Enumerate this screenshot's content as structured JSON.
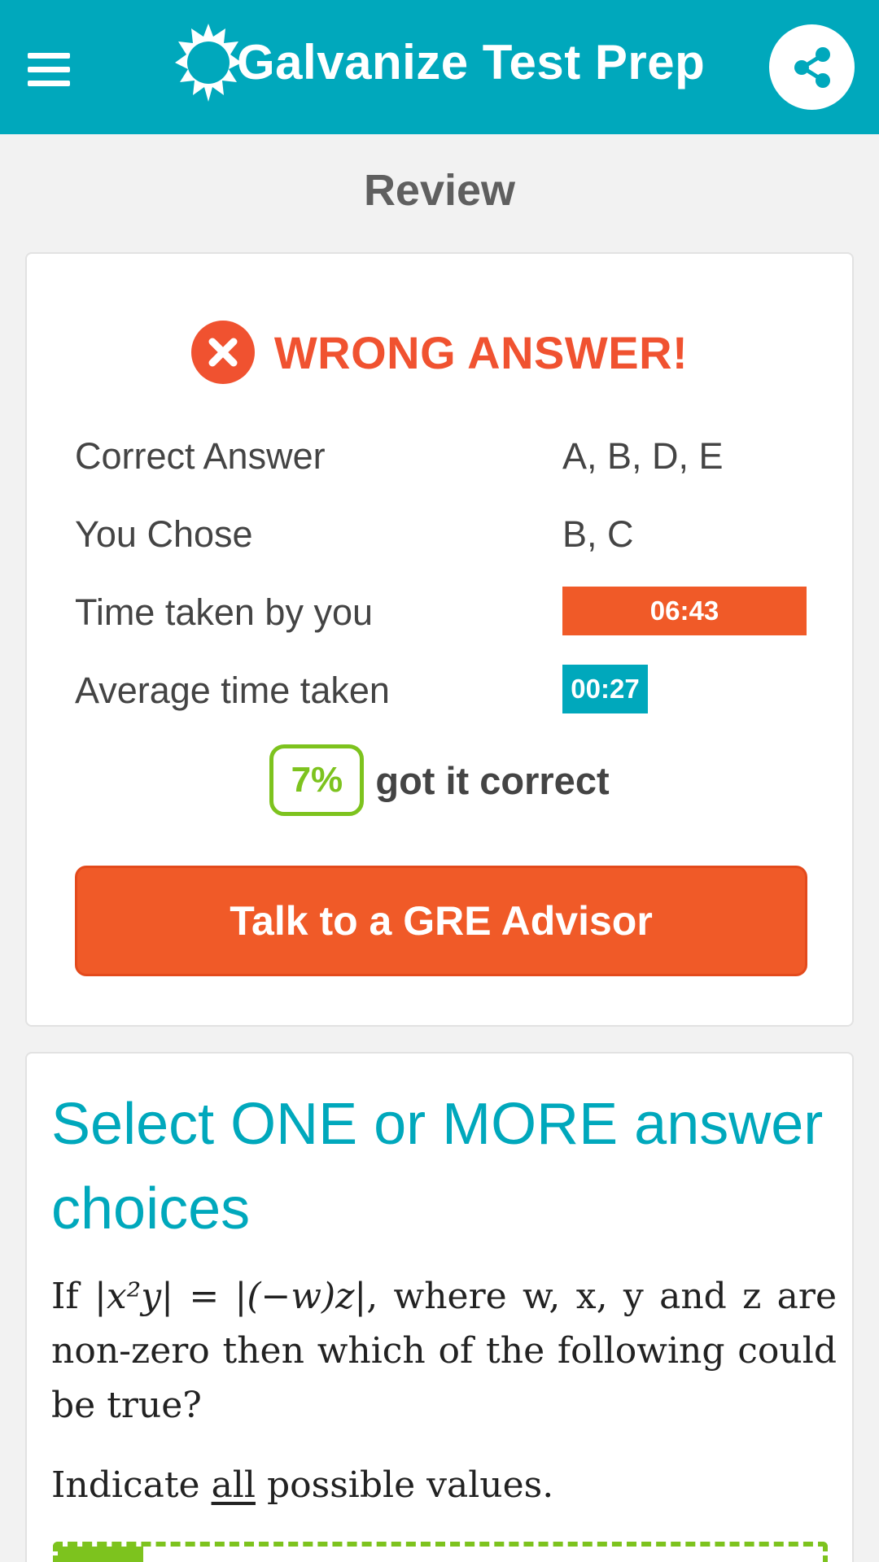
{
  "app": {
    "title": "Galvanize Test Prep",
    "brand_color": "#00a8bc"
  },
  "header": {
    "menu_icon": "hamburger-menu-icon",
    "share_icon": "share-icon"
  },
  "page": {
    "heading": "Review"
  },
  "result": {
    "verdict": "WRONG ANSWER!",
    "verdict_icon": "x-circle-icon",
    "verdict_color": "#f05230",
    "rows": [
      {
        "label": "Correct Answer",
        "value": "A, B, D, E"
      },
      {
        "label": "You Chose",
        "value": "B, C"
      },
      {
        "label": "Time taken by you",
        "value": "06:43"
      },
      {
        "label": "Average time taken",
        "value": "00:27"
      }
    ],
    "percent_correct": "7%",
    "percent_text": "got it correct",
    "advisor_button": "Talk to a GRE Advisor",
    "accent_orange": "#f05a28",
    "accent_green": "#7dc31e"
  },
  "question": {
    "instruction": "Select ONE or MORE answer choices",
    "stem_prefix": "If",
    "stem_equation": "|x²y| = |(−w)z|",
    "stem_rest": ", where w, x, y and z are non-zero then which of the following could be true?",
    "indicate_prefix": "Indicate",
    "indicate_emphasis": "all",
    "indicate_suffix": "possible values."
  }
}
